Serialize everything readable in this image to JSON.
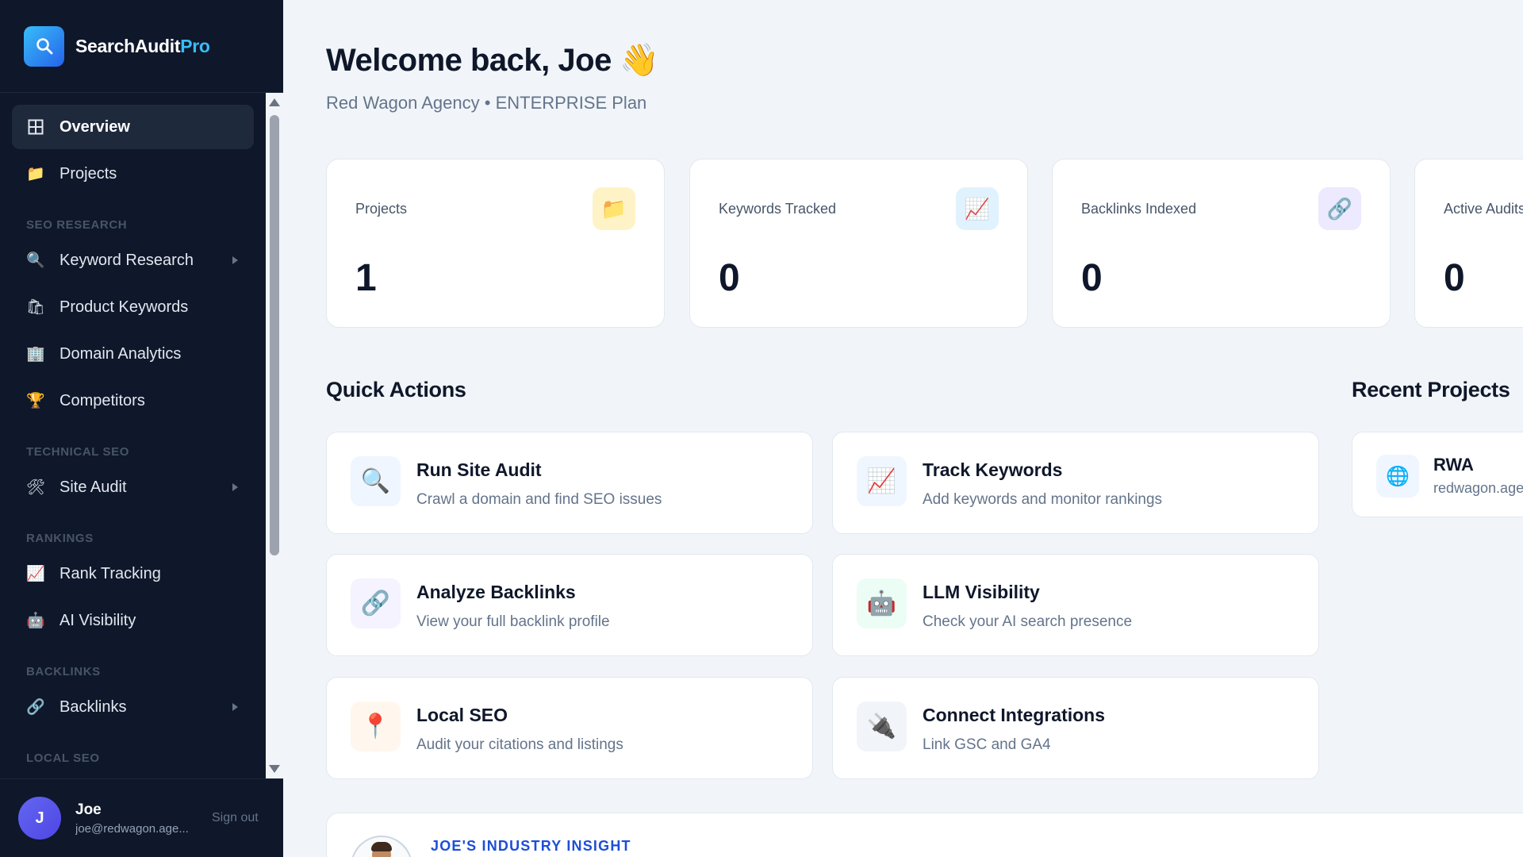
{
  "brand": {
    "name_main": "SearchAudit",
    "name_accent": "Pro",
    "accent_color": "#38bdf8"
  },
  "sidebar": {
    "items": [
      {
        "label": "Overview",
        "icon": "grid-icon",
        "active": true
      },
      {
        "label": "Projects",
        "icon": "folder-icon"
      }
    ],
    "sections": [
      {
        "title": "SEO RESEARCH",
        "items": [
          {
            "label": "Keyword Research",
            "icon": "magnifier-icon",
            "has_submenu": true
          },
          {
            "label": "Product Keywords",
            "icon": "shopping-bags-icon"
          },
          {
            "label": "Domain Analytics",
            "icon": "office-building-icon"
          },
          {
            "label": "Competitors",
            "icon": "trophy-icon"
          }
        ]
      },
      {
        "title": "TECHNICAL SEO",
        "items": [
          {
            "label": "Site Audit",
            "icon": "tools-icon",
            "has_submenu": true
          }
        ]
      },
      {
        "title": "RANKINGS",
        "items": [
          {
            "label": "Rank Tracking",
            "icon": "chart-up-icon"
          },
          {
            "label": "AI Visibility",
            "icon": "robot-icon"
          }
        ]
      },
      {
        "title": "BACKLINKS",
        "items": [
          {
            "label": "Backlinks",
            "icon": "link-icon",
            "has_submenu": true
          }
        ]
      },
      {
        "title": "LOCAL SEO",
        "items": []
      }
    ]
  },
  "user": {
    "initial": "J",
    "name": "Joe",
    "email": "joe@redwagon.age...",
    "signout_label": "Sign out"
  },
  "header": {
    "welcome": "Welcome back, Joe 👋",
    "subtitle": "Red Wagon Agency • ENTERPRISE Plan"
  },
  "stats": [
    {
      "label": "Projects",
      "value": "1",
      "icon": "folder-icon",
      "glyph": "📁",
      "icon_bg": "#fef3c7"
    },
    {
      "label": "Keywords Tracked",
      "value": "0",
      "icon": "chart-up-icon",
      "glyph": "📈",
      "icon_bg": "#e0f2fe"
    },
    {
      "label": "Backlinks Indexed",
      "value": "0",
      "icon": "link-icon",
      "glyph": "🔗",
      "icon_bg": "#ede9fe"
    },
    {
      "label": "Active Audits",
      "value": "0",
      "icon": "audit-icon",
      "glyph": "🔍",
      "icon_bg": "#dcfce7"
    }
  ],
  "quick_actions": {
    "title": "Quick Actions",
    "items": [
      {
        "title": "Run Site Audit",
        "desc": "Crawl a domain and find SEO issues",
        "icon": "magnifier-icon",
        "glyph": "🔍",
        "icon_bg": "#eff6ff"
      },
      {
        "title": "Track Keywords",
        "desc": "Add keywords and monitor rankings",
        "icon": "chart-up-icon",
        "glyph": "📈",
        "icon_bg": "#eff6ff"
      },
      {
        "title": "Analyze Backlinks",
        "desc": "View your full backlink profile",
        "icon": "link-icon",
        "glyph": "🔗",
        "icon_bg": "#f5f3ff"
      },
      {
        "title": "LLM Visibility",
        "desc": "Check your AI search presence",
        "icon": "robot-icon",
        "glyph": "🤖",
        "icon_bg": "#ecfdf5"
      },
      {
        "title": "Local SEO",
        "desc": "Audit your citations and listings",
        "icon": "pin-icon",
        "glyph": "📍",
        "icon_bg": "#fff7ed"
      },
      {
        "title": "Connect Integrations",
        "desc": "Link GSC and GA4",
        "icon": "plug-icon",
        "glyph": "🔌",
        "icon_bg": "#f1f5f9"
      }
    ]
  },
  "recent_projects": {
    "title": "Recent Projects",
    "items": [
      {
        "name": "RWA",
        "domain": "redwagon.agency",
        "icon": "globe-icon",
        "glyph": "🌐"
      }
    ]
  },
  "insight": {
    "label": "JOE'S INDUSTRY INSIGHT"
  }
}
